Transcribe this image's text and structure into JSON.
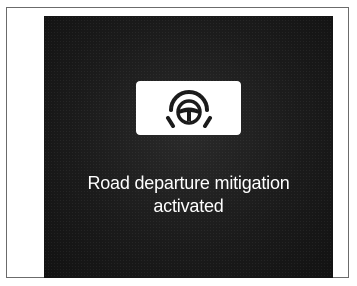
{
  "alert": {
    "icon": "road-departure-mitigation-icon",
    "message_line1": "Road departure mitigation",
    "message_line2": "activated"
  },
  "colors": {
    "screen_background": "#1b1b1b",
    "icon_box_background": "#ffffff",
    "icon_color": "#1a1a1a",
    "text_color": "#ffffff"
  }
}
